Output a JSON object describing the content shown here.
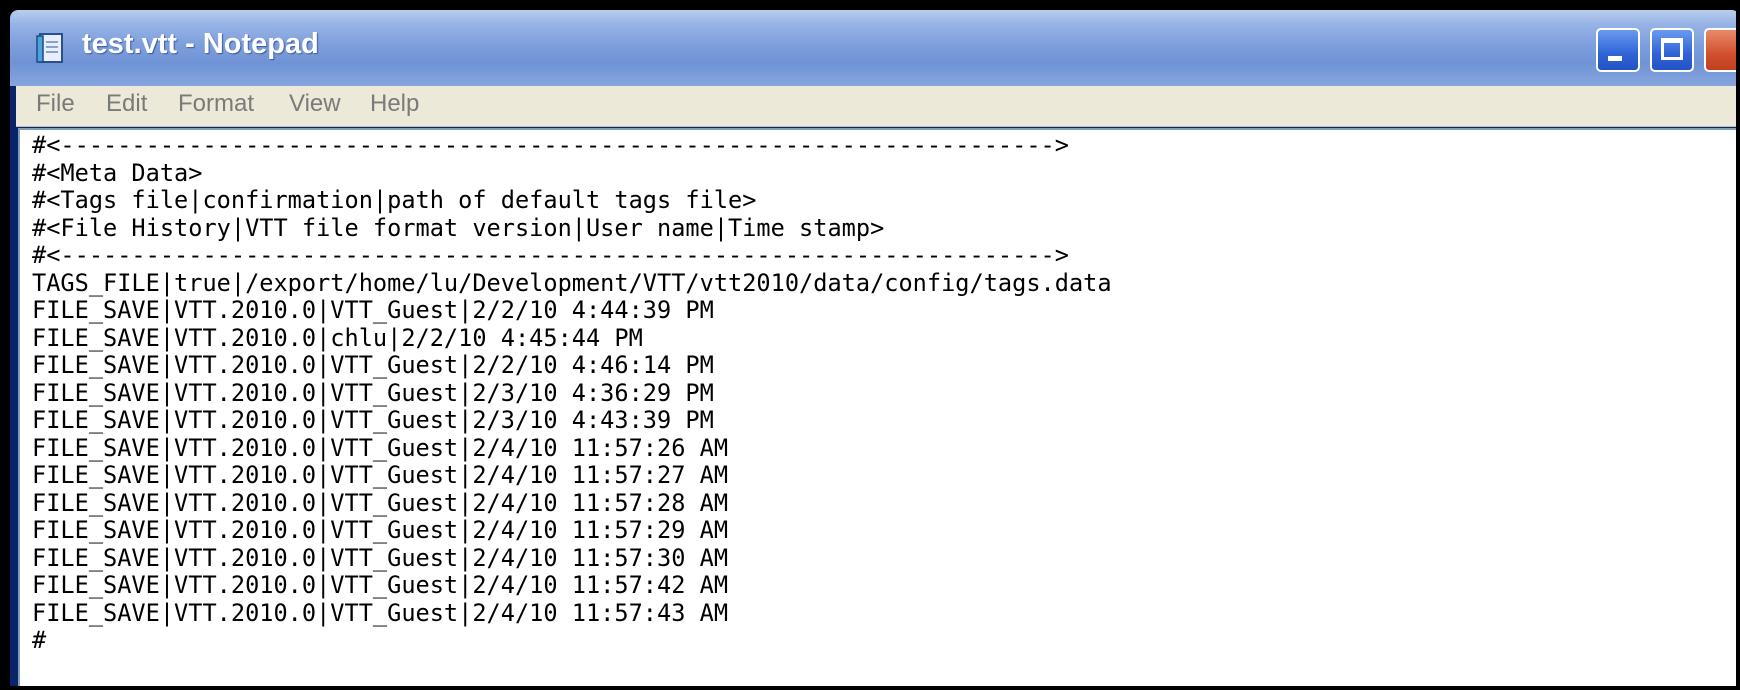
{
  "window": {
    "title": "test.vtt - Notepad",
    "app_icon": "notepad-icon",
    "controls": [
      "minimize-icon",
      "maximize-icon",
      "close-icon"
    ]
  },
  "menu": {
    "items": [
      {
        "label": "File"
      },
      {
        "label": "Edit"
      },
      {
        "label": "Format"
      },
      {
        "label": "View"
      },
      {
        "label": "Help"
      }
    ]
  },
  "document": {
    "text": "#<---------------------------------------------------------------------->\n#<Meta Data>\n#<Tags file|confirmation|path of default tags file>\n#<File History|VTT file format version|User name|Time stamp>\n#<---------------------------------------------------------------------->\nTAGS_FILE|true|/export/home/lu/Development/VTT/vtt2010/data/config/tags.data\nFILE_SAVE|VTT.2010.0|VTT_Guest|2/2/10 4:44:39 PM\nFILE_SAVE|VTT.2010.0|chlu|2/2/10 4:45:44 PM\nFILE_SAVE|VTT.2010.0|VTT_Guest|2/2/10 4:46:14 PM\nFILE_SAVE|VTT.2010.0|VTT_Guest|2/3/10 4:36:29 PM\nFILE_SAVE|VTT.2010.0|VTT_Guest|2/3/10 4:43:39 PM\nFILE_SAVE|VTT.2010.0|VTT_Guest|2/4/10 11:57:26 AM\nFILE_SAVE|VTT.2010.0|VTT_Guest|2/4/10 11:57:27 AM\nFILE_SAVE|VTT.2010.0|VTT_Guest|2/4/10 11:57:28 AM\nFILE_SAVE|VTT.2010.0|VTT_Guest|2/4/10 11:57:29 AM\nFILE_SAVE|VTT.2010.0|VTT_Guest|2/4/10 11:57:30 AM\nFILE_SAVE|VTT.2010.0|VTT_Guest|2/4/10 11:57:42 AM\nFILE_SAVE|VTT.2010.0|VTT_Guest|2/4/10 11:57:43 AM\n#"
  },
  "colors": {
    "titlebar": "#7e9fdc",
    "menubar": "#ece9d8",
    "editor_background": "#ffffff",
    "close_button": "#d2502e"
  }
}
